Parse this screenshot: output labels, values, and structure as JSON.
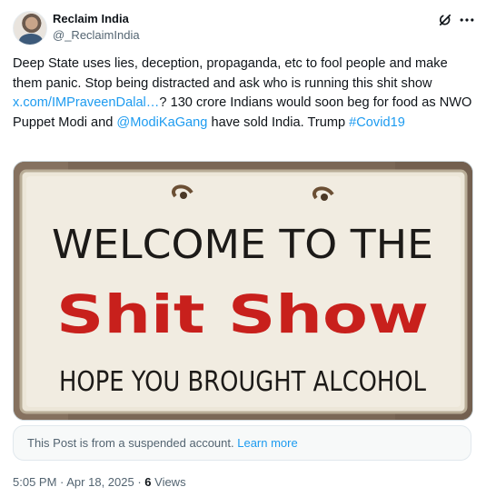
{
  "author": {
    "display_name": "Reclaim India",
    "handle": "@_ReclaimIndia"
  },
  "tweet": {
    "text_1": "Deep State uses lies, deception, propaganda, etc to fool people and make them panic. Stop being distracted and ask who is running this shit show ",
    "link_1": "x.com/IMPraveenDalal…",
    "text_2": "? 130 crore Indians would soon beg for food as NWO Puppet Modi and ",
    "mention": "@ModiKaGang",
    "text_3": " have sold India. Trump ",
    "hashtag": "#Covid19"
  },
  "media": {
    "sign_line_1": "WELCOME TO THE",
    "sign_line_2": "Shit Show",
    "sign_line_3": "HOPE YOU BROUGHT ALCOHOL"
  },
  "notice": {
    "text": "This Post is from a suspended account. ",
    "link": "Learn more"
  },
  "meta": {
    "time": "5:05 PM",
    "separator_1": " · ",
    "date": "Apr 18, 2025",
    "separator_2": " · ",
    "views_count": "6",
    "views_label": " Views"
  },
  "colors": {
    "link": "#1d9bf0",
    "text": "#0f1419",
    "secondary": "#536471",
    "sign_red": "#c8201c"
  },
  "icons": [
    "grok-icon",
    "more-icon"
  ]
}
